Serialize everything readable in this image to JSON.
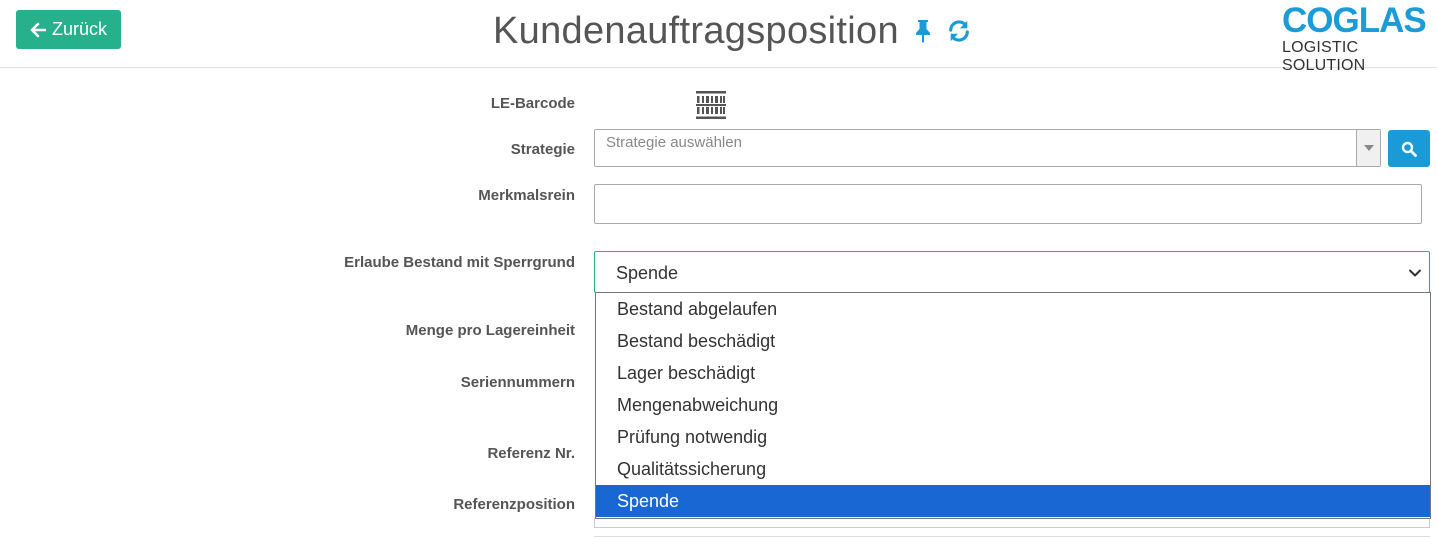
{
  "header": {
    "back_label": "Zurück",
    "title": "Kundenauftragsposition",
    "icons": [
      "pin-icon",
      "refresh-icon"
    ],
    "logo": {
      "main": "COGLAS",
      "sub": "LOGISTIC SOLUTION"
    }
  },
  "form": {
    "le_barcode_label": "LE-Barcode",
    "strategie_label": "Strategie",
    "strategie_placeholder": "Strategie auswählen",
    "merkmalsrein_label": "Merkmalsrein",
    "merkmalsrein_value": "",
    "sperrgrund_label": "Erlaube Bestand mit Sperrgrund",
    "sperrgrund_selected": "Spende",
    "menge_label": "Menge pro Lagereinheit",
    "seriennummern_label": "Seriennummern",
    "referenz_label": "Referenz Nr.",
    "referenzposition_label": "Referenzposition"
  },
  "dropdown": {
    "options": [
      "Bestand abgelaufen",
      "Bestand beschädigt",
      "Lager beschädigt",
      "Mengenabweichung",
      "Prüfung notwendig",
      "Qualitätssicherung",
      "Spende"
    ],
    "selected_index": 6
  },
  "colors": {
    "accent_green": "#26b08c",
    "accent_blue": "#1a9bd7",
    "selected_blue": "#1967d2",
    "logo_blue": "#1b9bd7"
  }
}
